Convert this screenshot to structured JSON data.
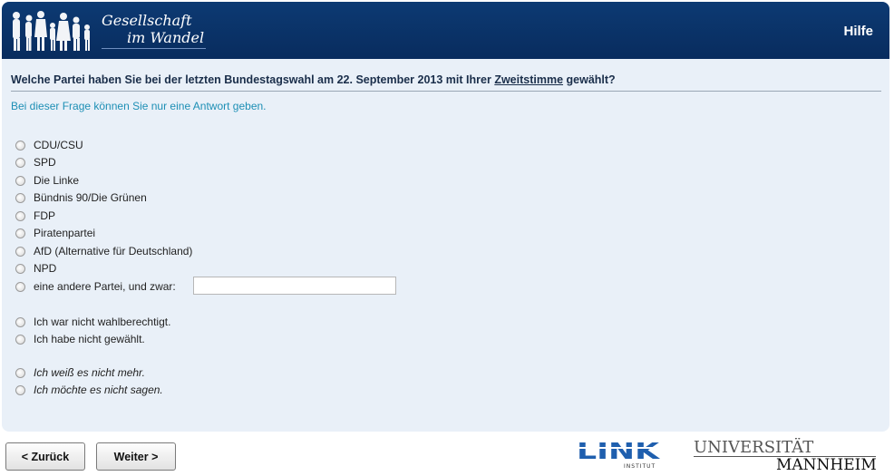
{
  "header": {
    "logo_line1": "Gesellschaft",
    "logo_line2": "im Wandel",
    "help_label": "Hilfe",
    "logo_icon": "silhouette-people-icon"
  },
  "question": {
    "text_before": "Welche Partei haben Sie bei der letzten Bundestagswahl am 22. September 2013 mit Ihrer",
    "text_link": "Zweitstimme",
    "text_after": "gewählt?",
    "hint": "Bei dieser Frage können Sie nur eine Antwort geben."
  },
  "options": [
    {
      "label": "CDU/CSU"
    },
    {
      "label": "SPD"
    },
    {
      "label": "Die Linke"
    },
    {
      "label": "Bündnis 90/Die Grünen"
    },
    {
      "label": "FDP"
    },
    {
      "label": "Piratenpartei"
    },
    {
      "label": "AfD (Alternative für Deutschland)"
    },
    {
      "label": "NPD"
    },
    {
      "label": "eine andere Partei, und zwar:"
    },
    {
      "label": "Ich war nicht wahlberechtigt."
    },
    {
      "label": "Ich habe nicht gewählt."
    },
    {
      "label": "Ich weiß es nicht mehr."
    },
    {
      "label": "Ich möchte es nicht sagen."
    }
  ],
  "other_party_input": {
    "value": "",
    "placeholder": ""
  },
  "nav": {
    "back_label": "< Zurück",
    "next_label": "Weiter >"
  },
  "footer": {
    "link_logo_text": "LINK",
    "link_logo_sub": "INSTITUT",
    "uni_line1": "UNIVERSITÄT",
    "uni_line2": "MANNHEIM"
  },
  "colors": {
    "header_bg": "#0b356b",
    "page_bg": "#e9f0f8",
    "hint_text": "#1d8fb5",
    "link_logo": "#1f5fae"
  }
}
